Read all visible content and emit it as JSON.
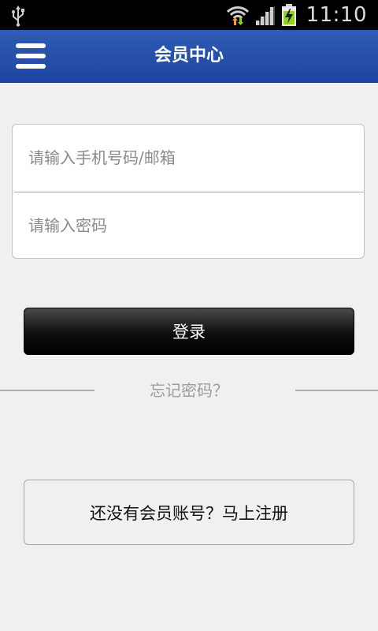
{
  "status_bar": {
    "time": "11:10",
    "icons": [
      "usb-icon",
      "wifi-icon",
      "signal-icon",
      "battery-charging-icon"
    ]
  },
  "header": {
    "title": "会员中心",
    "menu_icon": "hamburger-menu-icon"
  },
  "login_form": {
    "account_placeholder": "请输入手机号码/邮箱",
    "password_placeholder": "请输入密码",
    "login_label": "登录"
  },
  "forgot_password": {
    "label": "忘记密码？"
  },
  "register": {
    "label": "还没有会员账号？马上注册"
  },
  "colors": {
    "header_blue": "#2650ac",
    "battery_green": "#8ed321",
    "wifi_orange": "#f3a01b",
    "page_background": "#f0f0f0"
  }
}
